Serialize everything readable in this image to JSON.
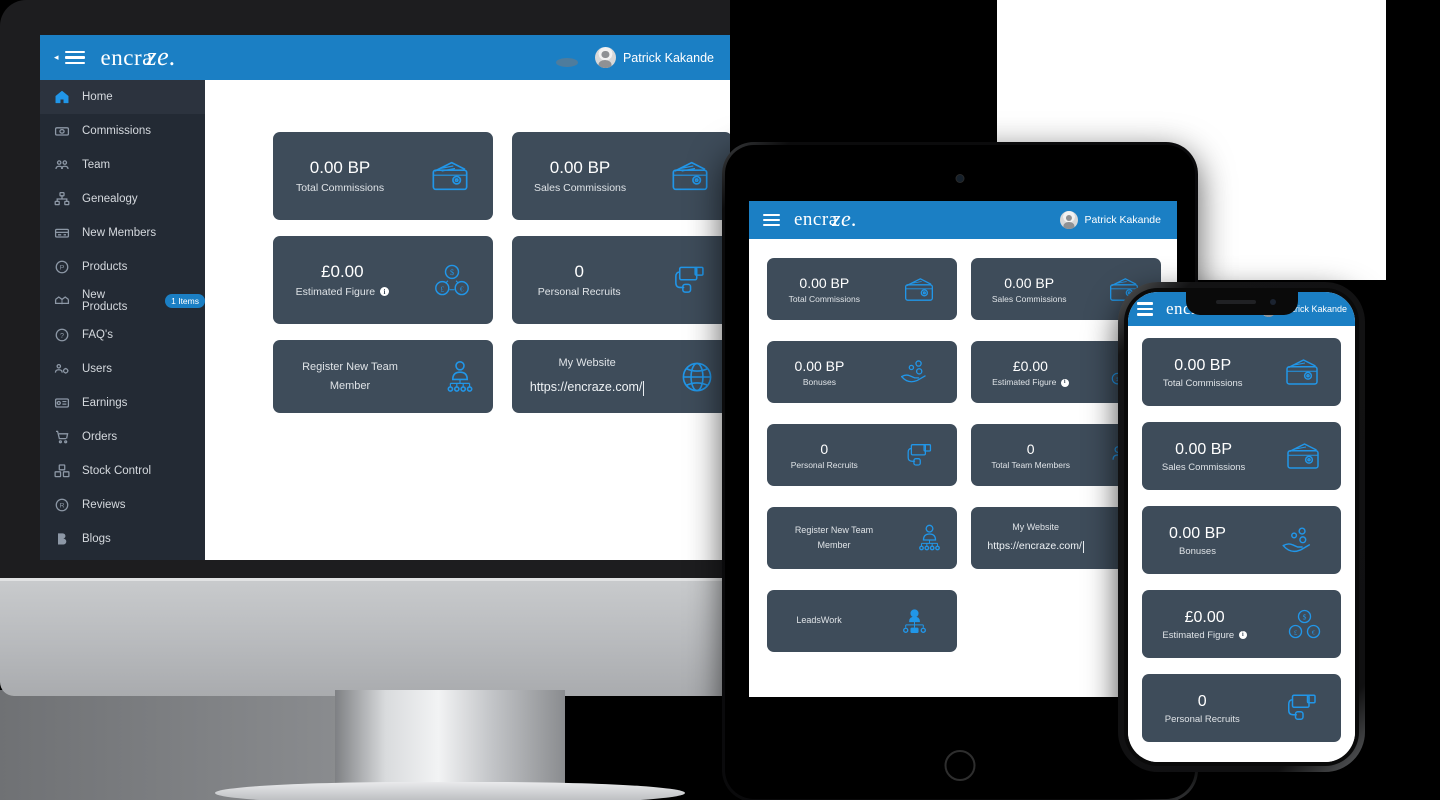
{
  "app": {
    "brand": "encra",
    "brand_swirl": "ze.",
    "brand_full": "encraze.",
    "accent_color": "#1b7fc4",
    "card_color": "#3e4c5a",
    "sidebar_color": "#232a34"
  },
  "topbar": {
    "menu_icon": "hamburger-icon",
    "collapse_icon": "chevron-left-icon",
    "user_name": "Patrick Kakande",
    "avatar_icon": "user-avatar-icon"
  },
  "sidebar": {
    "items": [
      {
        "label": "Home",
        "icon": "home-icon",
        "active": true,
        "badge": ""
      },
      {
        "label": "Commissions",
        "icon": "money-icon",
        "active": false,
        "badge": ""
      },
      {
        "label": "Team",
        "icon": "team-icon",
        "active": false,
        "badge": ""
      },
      {
        "label": "Genealogy",
        "icon": "sitemap-icon",
        "active": false,
        "badge": ""
      },
      {
        "label": "New Members",
        "icon": "id-card-icon",
        "active": false,
        "badge": ""
      },
      {
        "label": "Products",
        "icon": "p-circle-icon",
        "active": false,
        "badge": ""
      },
      {
        "label": "New Products",
        "icon": "box-open-icon",
        "active": false,
        "badge": "1 Items"
      },
      {
        "label": "FAQ's",
        "icon": "question-icon",
        "active": false,
        "badge": ""
      },
      {
        "label": "Users",
        "icon": "users-cog-icon",
        "active": false,
        "badge": ""
      },
      {
        "label": "Earnings",
        "icon": "earnings-icon",
        "active": false,
        "badge": ""
      },
      {
        "label": "Orders",
        "icon": "cart-icon",
        "active": false,
        "badge": ""
      },
      {
        "label": "Stock Control",
        "icon": "boxes-icon",
        "active": false,
        "badge": ""
      },
      {
        "label": "Reviews",
        "icon": "r-circle-icon",
        "active": false,
        "badge": ""
      },
      {
        "label": "Blogs",
        "icon": "blog-icon",
        "active": false,
        "badge": ""
      }
    ]
  },
  "cards": {
    "total_commissions": {
      "value": "0.00 BP",
      "label": "Total Commissions",
      "icon": "wallet-icon"
    },
    "sales_commissions": {
      "value": "0.00 BP",
      "label": "Sales Commissions",
      "icon": "wallet-icon"
    },
    "bonuses": {
      "value": "0.00 BP",
      "label": "Bonuses",
      "icon": "hand-coins-icon"
    },
    "estimated_figure": {
      "value": "£0.00",
      "label": "Estimated Figure",
      "icon": "coins-exchange-icon",
      "info": "i"
    },
    "personal_recruits": {
      "value": "0",
      "label": "Personal Recruits",
      "icon": "recruit-icon"
    },
    "total_team_members": {
      "value": "0",
      "label": "Total Team Members",
      "icon": "team-group-icon"
    },
    "register_member": {
      "label": "Register New Team Member",
      "icon": "add-member-icon"
    },
    "my_website": {
      "label": "My Website",
      "url": "https://encraze.com/",
      "icon": "globe-icon"
    },
    "leads_work": {
      "label": "LeadsWork",
      "icon": "leads-icon"
    }
  },
  "devices": {
    "desktop": "imac-desktop",
    "tablet": "ipad-tablet",
    "phone": "iphone-mobile"
  }
}
